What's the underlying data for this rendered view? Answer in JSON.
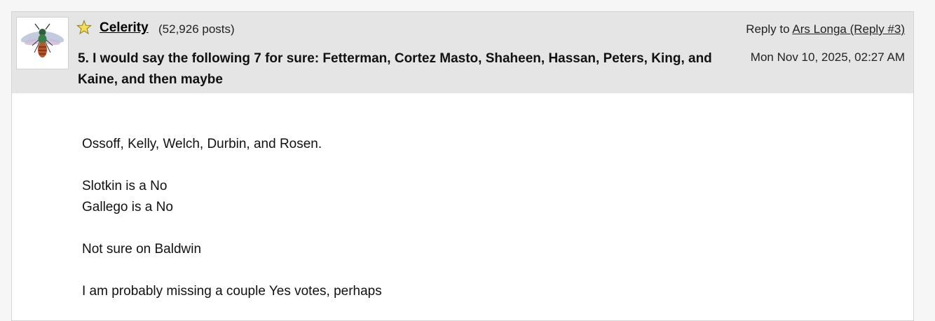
{
  "post": {
    "author": "Celerity",
    "post_count": "(52,926 posts)",
    "reply_to_prefix": "Reply to ",
    "reply_to_link": "Ars Longa (Reply #3)",
    "date": "Mon Nov 10, 2025, 02:27 AM",
    "title": "5. I would say the following 7 for sure: Fetterman, Cortez Masto, Shaheen, Hassan, Peters, King, and Kaine, and then maybe",
    "body": [
      "Ossoff, Kelly, Welch, Durbin, and Rosen.",
      "",
      "Slotkin is a No",
      "Gallego is a No",
      "",
      "Not sure on Baldwin",
      "",
      "I am probably missing a couple Yes votes, perhaps"
    ]
  },
  "icons": {
    "star": "star-icon",
    "avatar": "wasp-avatar"
  },
  "colors": {
    "header_bg": "#e5e5e5",
    "page_bg": "#f6f6f6",
    "star_fill": "#f5dd5a"
  }
}
